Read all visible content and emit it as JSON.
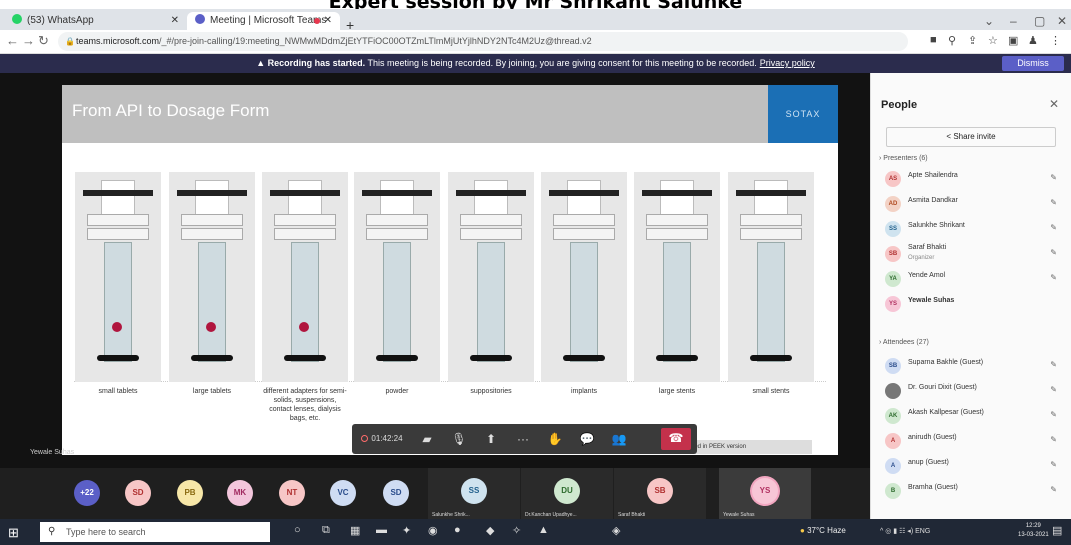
{
  "caption": "Expert session by Mr Shrikant Salunke",
  "browser": {
    "tabs": [
      {
        "title": "(53) WhatsApp",
        "color": "#25d366"
      },
      {
        "title": "Meeting | Microsoft Teams",
        "color": "#5b5fc7"
      }
    ],
    "new_tab": "+",
    "url_host": "teams.microsoft.com",
    "url_path": "/_#/pre-join-calling/19:meeting_NWMwMDdmZjEtYTFiOC00OTZmLTlmMjUtYjlhNDY2NTc4M2Uz@thread.v2"
  },
  "recording_banner": {
    "title": "Recording has started.",
    "message": "This meeting is being recorded. By joining, you are giving consent for this meeting to be recorded.",
    "link": "Privacy policy",
    "dismiss": "Dismiss"
  },
  "slide": {
    "title": "From API to Dosage Form",
    "brand": "SOTAX",
    "footnote": "used in PEEK version",
    "products": [
      {
        "label": "small tablets",
        "dot": true
      },
      {
        "label": "large tablets",
        "dot": true
      },
      {
        "label": "different adapters for semi-solids, suspensions, contact lenses, dialysis bags, etc.",
        "dot": true
      },
      {
        "label": "powder",
        "dot": false
      },
      {
        "label": "suppositories",
        "dot": false
      },
      {
        "label": "implants",
        "dot": false
      },
      {
        "label": "large stents",
        "dot": false
      },
      {
        "label": "small stents",
        "dot": false
      }
    ]
  },
  "speaker": "Yewale Suhas",
  "call_bar": {
    "timer": "01:42:24"
  },
  "people": {
    "title": "People",
    "share": "Share invite",
    "presenters_label": "Presenters (6)",
    "attendees_label": "Attendees (27)",
    "presenters": [
      {
        "initials": "AS",
        "name": "Apte Shailendra",
        "color": "#f7c6c6",
        "fg": "#b03030"
      },
      {
        "initials": "AD",
        "name": "Asmita Dandkar",
        "color": "#f3d2c5",
        "fg": "#b04a20"
      },
      {
        "initials": "SS",
        "name": "Salunkhe Shrikant",
        "color": "#cfe3ef",
        "fg": "#1f5f8b"
      },
      {
        "initials": "SB",
        "name": "Saraf Bhakti",
        "sub": "Organizer",
        "color": "#f7c6c6",
        "fg": "#b03030"
      },
      {
        "initials": "YA",
        "name": "Yende Amol",
        "color": "#cfe8cf",
        "fg": "#2d6b2d"
      },
      {
        "initials": "YS",
        "name": "Yewale Suhas",
        "color": "#f7c6d6",
        "fg": "#b03060",
        "bold": true
      }
    ],
    "attendees": [
      {
        "initials": "SB",
        "name": "Suparna Bakhle (Guest)",
        "color": "#cfdcf3",
        "fg": "#2a4c8b"
      },
      {
        "initials": "",
        "name": "Dr. Gouri Dixit (Guest)",
        "color": "#777777",
        "fg": "#ffffff"
      },
      {
        "initials": "AK",
        "name": "Akash Kallpesar (Guest)",
        "color": "#cfe8cf",
        "fg": "#2d6b2d"
      },
      {
        "initials": "A",
        "name": "anirudh (Guest)",
        "color": "#f7c6c6",
        "fg": "#b03030"
      },
      {
        "initials": "A",
        "name": "anup (Guest)",
        "color": "#cfdcf3",
        "fg": "#2a4c8b"
      },
      {
        "initials": "B",
        "name": "Bramha (Guest)",
        "color": "#cfe8cf",
        "fg": "#2d6b2d"
      }
    ]
  },
  "gallery": [
    {
      "initials": "+22",
      "color": "#5b5fc7",
      "fg": "#ffffff"
    },
    {
      "initials": "SD",
      "color": "#f7c6c6",
      "fg": "#b03030"
    },
    {
      "initials": "PB",
      "color": "#f7e7a8",
      "fg": "#8a6a10"
    },
    {
      "initials": "MK",
      "color": "#f3c6dc",
      "fg": "#a02a60"
    },
    {
      "initials": "NT",
      "color": "#f7c6c6",
      "fg": "#b03030"
    },
    {
      "initials": "VC",
      "color": "#cfdcf3",
      "fg": "#2a4c8b"
    },
    {
      "initials": "SD",
      "color": "#cfdcf3",
      "fg": "#2a4c8b"
    },
    {
      "initials": "SS",
      "color": "#cfe3ef",
      "fg": "#1f5f8b",
      "name": "Salunkhe Shrik..."
    },
    {
      "initials": "DU",
      "color": "#cfe8cf",
      "fg": "#2d6b2d",
      "name": "Dr.Kanchan Upadhye..."
    },
    {
      "initials": "SB",
      "color": "#f7c6c6",
      "fg": "#b03030",
      "name": "Saraf Bhakti"
    },
    {
      "initials": "YS",
      "color": "#f7c6d6",
      "fg": "#b03060",
      "name": "Yewale Suhas"
    }
  ],
  "taskbar": {
    "search_placeholder": "Type here to search",
    "weather": "37°C Haze",
    "lang": "ENG",
    "time": "12:29",
    "date": "13-03-2021"
  }
}
